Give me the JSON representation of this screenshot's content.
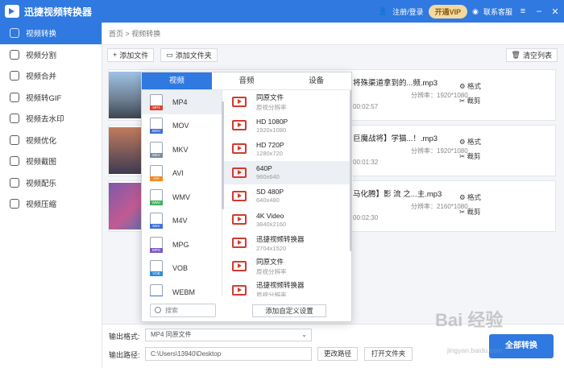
{
  "app": {
    "title": "迅捷视频转换器",
    "login": "注册/登录",
    "vip": "开通VIP",
    "service": "联系客服"
  },
  "sidebar": {
    "items": [
      {
        "label": "视频转换",
        "active": true
      },
      {
        "label": "视频分割"
      },
      {
        "label": "视频合并"
      },
      {
        "label": "视频转GIF"
      },
      {
        "label": "视频去水印"
      },
      {
        "label": "视频优化"
      },
      {
        "label": "视频截图"
      },
      {
        "label": "视频配乐"
      },
      {
        "label": "视频压缩"
      }
    ]
  },
  "breadcrumb": "首页 > 视频转换",
  "toolbar": {
    "add_file": "添加文件",
    "add_folder": "添加文件夹",
    "clear": "清空列表"
  },
  "files": [
    {
      "name": "将殊渠道拿到的...频.mp3",
      "res": "分辨率：1920*1080",
      "dur": "00:02:57",
      "format_label": "格式",
      "cut_label": "裁剪"
    },
    {
      "name": "巨魔战将】学猫...！.mp3",
      "res": "分辨率：1920*1080",
      "dur": "00:01:32",
      "format_label": "格式",
      "cut_label": "裁剪"
    },
    {
      "name": "马化腾】影 流 之...主.mp3",
      "res": "分辨率：2160*1080",
      "dur": "00:02:30",
      "format_label": "格式",
      "cut_label": "裁剪"
    }
  ],
  "popup": {
    "tabs": [
      "视频",
      "音频",
      "设备"
    ],
    "formats": [
      {
        "name": "MP4",
        "color": "#d9412e"
      },
      {
        "name": "MOV",
        "color": "#3d6fd8"
      },
      {
        "name": "MKV",
        "color": "#7b8aa0"
      },
      {
        "name": "AVI",
        "color": "#f08a24"
      },
      {
        "name": "WMV",
        "color": "#3faf5a"
      },
      {
        "name": "M4V",
        "color": "#3d6fd8"
      },
      {
        "name": "MPG",
        "color": "#7a58c4"
      },
      {
        "name": "VOB",
        "color": "#2a8bdc"
      },
      {
        "name": "WEBM",
        "color": "#3d6fd8"
      }
    ],
    "resolutions": [
      {
        "name": "同原文件",
        "sub": "原视分辨率"
      },
      {
        "name": "HD 1080P",
        "sub": "1920x1080"
      },
      {
        "name": "HD 720P",
        "sub": "1280x720"
      },
      {
        "name": "640P",
        "sub": "960x640"
      },
      {
        "name": "SD 480P",
        "sub": "640x480"
      },
      {
        "name": "4K Video",
        "sub": "3840x2160"
      },
      {
        "name": "迅捷视频转换器",
        "sub": "2704x1520"
      },
      {
        "name": "同原文件",
        "sub": "原视分辨率"
      },
      {
        "name": "迅捷视频转换器",
        "sub": "原视分辨率"
      }
    ],
    "search_placeholder": "搜索",
    "custom_button": "添加自定义设置"
  },
  "bottom": {
    "format_label": "输出格式:",
    "format_value": "MP4  同原文件",
    "path_label": "输出路径:",
    "path_value": "C:\\Users\\13940\\Desktop",
    "change_path": "更改路径",
    "open_folder": "打开文件夹",
    "convert_all": "全部转换"
  },
  "watermark": {
    "logo": "Bai 经验",
    "url": "jingyan.baidu.com"
  }
}
